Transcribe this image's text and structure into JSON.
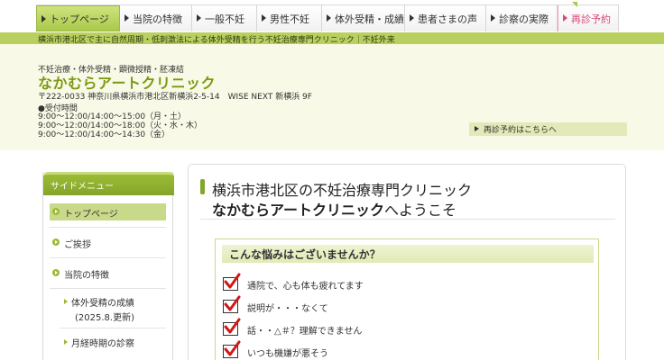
{
  "nav": {
    "items": [
      {
        "label": "トップページ"
      },
      {
        "label": "当院の特徴"
      },
      {
        "label": "一般不妊"
      },
      {
        "label": "男性不妊"
      },
      {
        "label": "体外受精・成績"
      },
      {
        "label": "患者さまの声"
      },
      {
        "label": "診察の実際"
      },
      {
        "label": "再診予約"
      }
    ]
  },
  "strip": {
    "text": "横浜市港北区で主に自然周期・低刺激法による体外受精を行う不妊治療専門クリニック｜不妊外来"
  },
  "header": {
    "subtitle": "不妊治療・体外受精・顕微授精・胚凍結",
    "clinic_name": "なかむらアートクリニック",
    "address": "〒222-0033 神奈川県横浜市港北区新横浜2-5-14　WISE NEXT 新横浜 9F",
    "hours_label": "●受付時間",
    "hours": [
      "9:00～12:00/14:00～15:00（月・土）",
      "9:00～12:00/14:00～18:00（火・水・木）",
      "9:00～12:00/14:00～14:30（金）"
    ],
    "revisit_button": "再診予約はこちらへ"
  },
  "sidebar": {
    "title": "サイドメニュー",
    "items": [
      {
        "label": "トップページ"
      },
      {
        "label": "ご挨拶"
      },
      {
        "label": "当院の特徴"
      }
    ],
    "subitems": [
      {
        "label": "体外受精の成績"
      },
      {
        "label": "(2025.8.更新)"
      },
      {
        "label": "月経時期の診察"
      }
    ]
  },
  "main": {
    "welcome_line1": "横浜市港北区の不妊治療専門クリニック",
    "welcome_clinic": "なかむらアートクリニック",
    "welcome_suffix": "へようこそ",
    "worry_title": "こんな悩みはございませんか？",
    "worries": [
      "通院で、心も体も疲れてます",
      "説明が・・・なくて",
      "話・・△＃？理解できません",
      "いつも機嫌が悪そう"
    ]
  },
  "colors": {
    "accent_green": "#9cbb36",
    "strip_green": "#b9cf5f",
    "pink": "#d8467a"
  }
}
